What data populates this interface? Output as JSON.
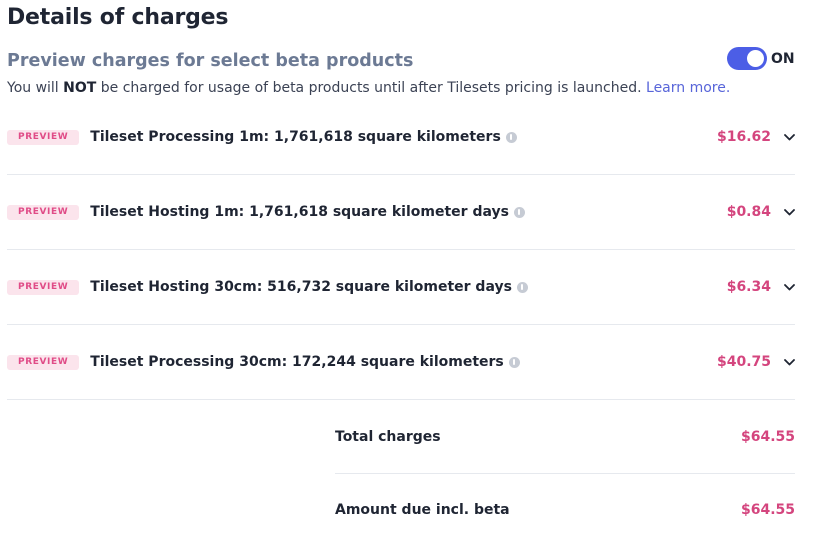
{
  "header": {
    "title": "Details of charges",
    "subtitle": "Preview charges for select beta products",
    "note_prefix": "You will ",
    "note_bold": "NOT",
    "note_suffix": " be charged for usage of beta products until after Tilesets pricing is launched. ",
    "note_link": "Learn more."
  },
  "toggle": {
    "label": "ON",
    "state": true,
    "color": "#4c5ee6"
  },
  "charges": [
    {
      "badge": "PREVIEW",
      "label": "Tileset Processing 1m: 1,761,618 square kilometers",
      "amount": "$16.62"
    },
    {
      "badge": "PREVIEW",
      "label": "Tileset Hosting 1m: 1,761,618 square kilometer days",
      "amount": "$0.84"
    },
    {
      "badge": "PREVIEW",
      "label": "Tileset Hosting 30cm: 516,732 square kilometer days",
      "amount": "$6.34"
    },
    {
      "badge": "PREVIEW",
      "label": "Tileset Processing 30cm: 172,244 square kilometers",
      "amount": "$40.75"
    }
  ],
  "summary": {
    "total_label": "Total charges",
    "total_amount": "$64.55",
    "due_label": "Amount due incl. beta",
    "due_amount": "$64.55"
  },
  "colors": {
    "amount": "#d4457e",
    "badge_bg": "#fbe4ec",
    "badge_text": "#e04c87",
    "link": "#5865d9"
  },
  "icons": {
    "info": "info-icon",
    "expand": "chevron-down-icon"
  }
}
